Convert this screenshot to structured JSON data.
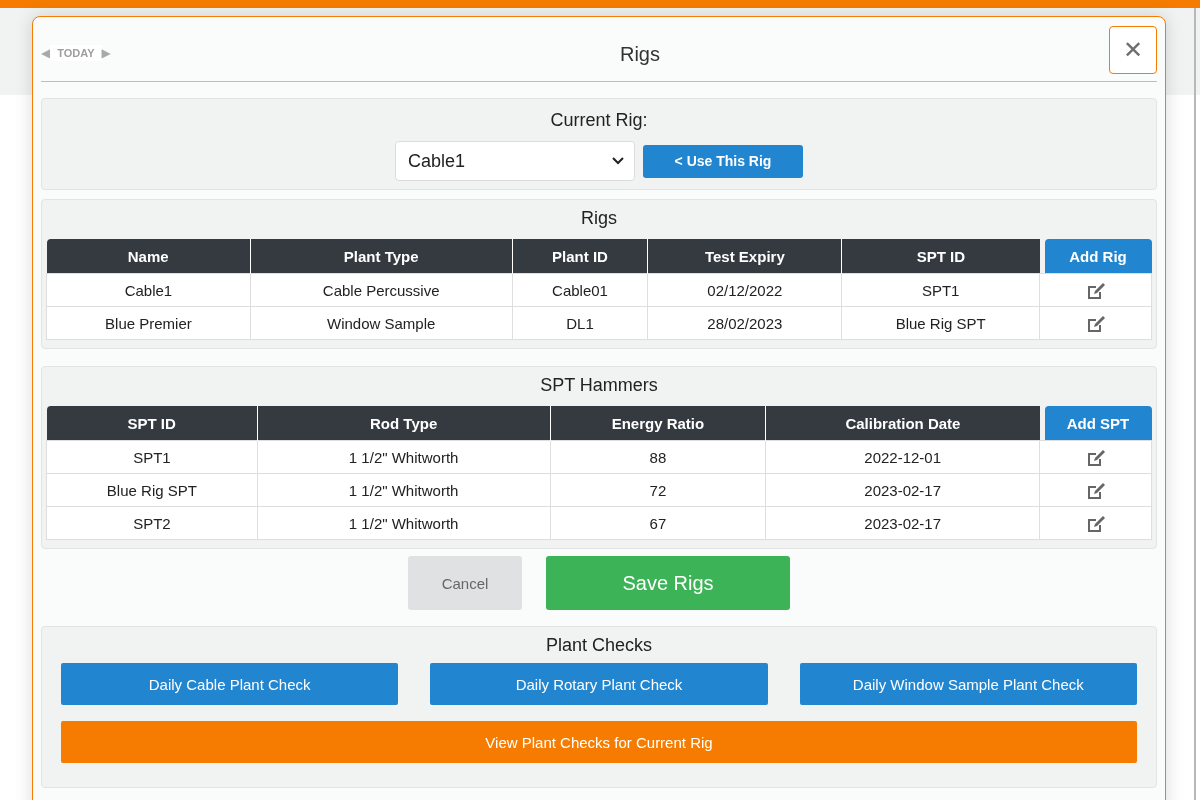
{
  "nav": {
    "prev_glyph": "◀",
    "label": "TODAY",
    "next_glyph": "▶"
  },
  "modal": {
    "title": "Rigs",
    "close_glyph": "✕"
  },
  "current_rig": {
    "heading": "Current Rig:",
    "value": "Cable1",
    "use_button": "< Use This Rig"
  },
  "rigs": {
    "heading": "Rigs",
    "columns": [
      "Name",
      "Plant Type",
      "Plant ID",
      "Test Expiry",
      "SPT ID"
    ],
    "add_button": "Add Rig",
    "rows": [
      [
        "Cable1",
        "Cable Percussive",
        "Cable01",
        "02/12/2022",
        "SPT1"
      ],
      [
        "Blue Premier",
        "Window Sample",
        "DL1",
        "28/02/2023",
        "Blue Rig SPT"
      ]
    ]
  },
  "spt_hammers": {
    "heading": "SPT Hammers",
    "columns": [
      "SPT ID",
      "Rod Type",
      "Energy Ratio",
      "Calibration Date"
    ],
    "add_button": "Add SPT",
    "rows": [
      [
        "SPT1",
        "1 1/2\" Whitworth",
        "88",
        "2022-12-01"
      ],
      [
        "Blue Rig SPT",
        "1 1/2\" Whitworth",
        "72",
        "2023-02-17"
      ],
      [
        "SPT2",
        "1 1/2\" Whitworth",
        "67",
        "2023-02-17"
      ]
    ]
  },
  "actions": {
    "cancel": "Cancel",
    "save": "Save Rigs"
  },
  "plant_checks": {
    "heading": "Plant Checks",
    "buttons": [
      "Daily Cable Plant Check",
      "Daily Rotary Plant Check",
      "Daily Window Sample Plant Check"
    ],
    "view_button": "View Plant Checks for Current Rig"
  }
}
